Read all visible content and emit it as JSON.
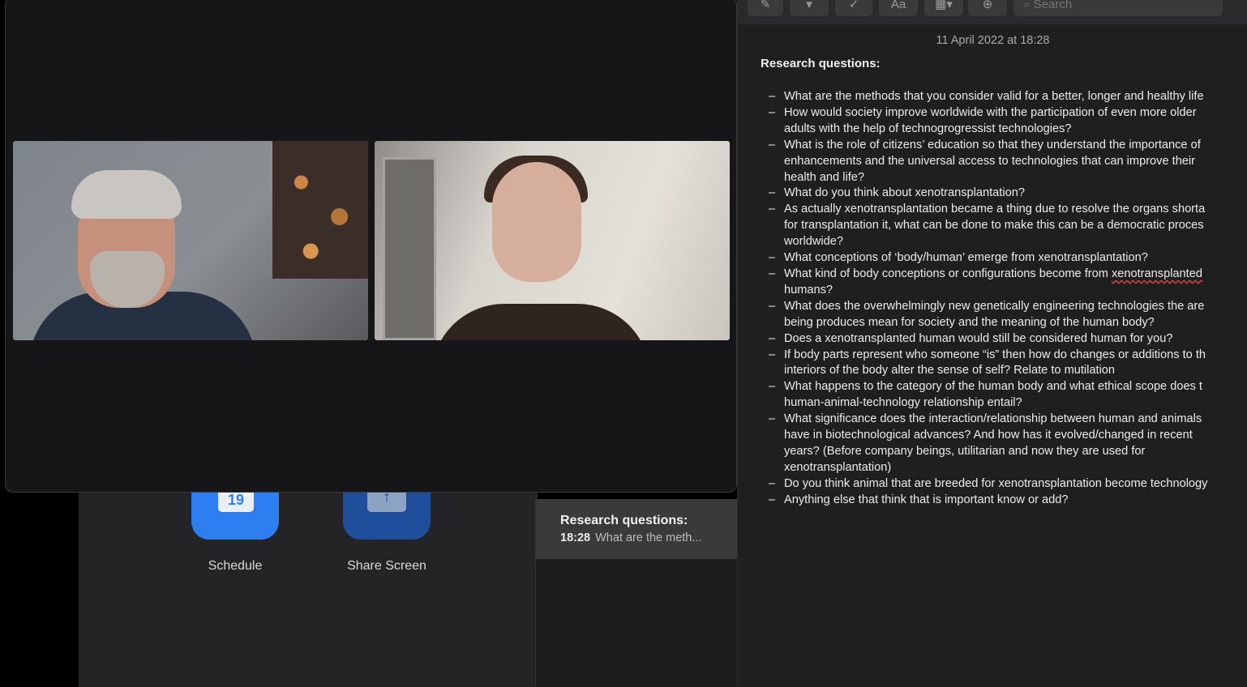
{
  "home": {
    "schedule": {
      "date": "19",
      "label": "Schedule"
    },
    "share": {
      "icon": "↑",
      "label": "Share Screen"
    }
  },
  "notes_list": {
    "item": {
      "title": "Research questions:",
      "time": "18:28",
      "snippet": "What are the meth..."
    }
  },
  "editor": {
    "toolbar": {
      "compose_icon": "✎",
      "format_label": "Aa",
      "check_icon": "✓",
      "search_placeholder": "Search"
    },
    "date": "11 April 2022 at 18:28",
    "heading": "Research questions:",
    "questions": [
      [
        "What are the methods that you consider valid for a better, longer and healthy life"
      ],
      [
        "How would society improve worldwide with the participation of even more older",
        "adults with the help of technogrogressist technologies?"
      ],
      [
        "What is the role of citizens’ education so that they understand the importance of",
        "enhancements and the universal access to technologies that can improve their",
        "health and life?"
      ],
      [
        "What do you think about xenotransplantation?"
      ],
      [
        "As actually xenotransplantation became a thing due to resolve the organs shorta",
        "for transplantation it, what can be done to make this can be a democratic proces",
        "worldwide?"
      ],
      [
        "What conceptions of ‘body/human’ emerge from xenotransplantation?"
      ],
      [
        "What kind of body conceptions or configurations become from",
        "humans?"
      ],
      [
        "What does the overwhelmingly new genetically engineering technologies the are",
        "being produces mean for society and the meaning of the human body?"
      ],
      [
        "Does a xenotransplanted human would still be considered human for you?"
      ],
      [
        "If body parts represent who someone “is” then how do changes or additions to th",
        "interiors of the body alter the sense of self? Relate to mutilation"
      ],
      [
        "What happens to the category of the human body and what ethical scope does t",
        "human-animal-technology relationship entail?"
      ],
      [
        "What significance does the interaction/relationship between human and animals",
        "have in biotechnological advances? And how has it evolved/changed in recent",
        "years? (Before company beings, utilitarian and now they are used for",
        "xenotransplantation)"
      ],
      [
        "Do you think animal that are breeded for xenotransplantation become technology"
      ],
      [
        "Anything else that think that is important know or add?"
      ]
    ],
    "misspelled_word": "xenotransplanted"
  }
}
